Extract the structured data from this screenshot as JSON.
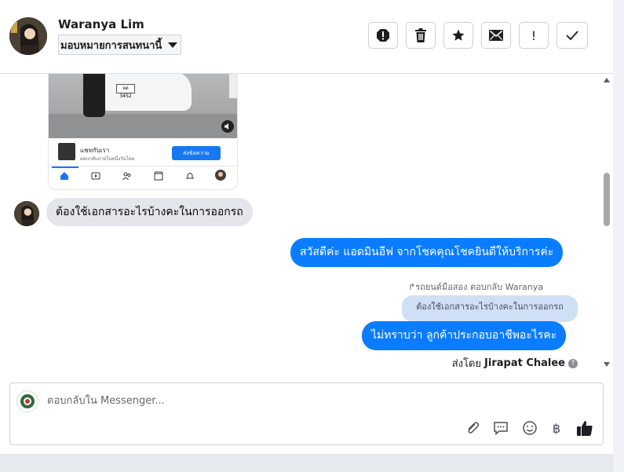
{
  "header": {
    "name": "Waranya Lim",
    "assign_label": "มอบหมายการสนทนานี้",
    "actions": [
      "spam-icon",
      "trash-icon",
      "star-icon",
      "envelope-icon",
      "important-icon",
      "check-icon"
    ],
    "important_glyph": "!"
  },
  "phone_preview": {
    "plate": "จต 3452",
    "card_title": "แชทกับเรา",
    "card_sub": "ตอบกลับภายในหนึ่งวันโดย",
    "card_button": "ส่งข้อความ"
  },
  "messages": {
    "incoming_1": "ต้องใช้เอกสารอะไรบ้างคะในการออกรถ",
    "outgoing_1": "สวัสดีค่ะ แอดมินอีฟ จากโชคคุณโชคยินดีให้บริการค่ะ",
    "reply_note": "รถยนต์มือสอง ตอบกลับ Waranya",
    "quoted": "ต้องใช้เอกสารอะไรบ้างคะในการออกรถ",
    "outgoing_2": "ไม่ทราบว่า ลูกค้าประกอบอาชีพอะไรคะ",
    "sent_by_label": "ส่งโดย",
    "sent_by_name": "Jirapat Chalee",
    "info_glyph": "?"
  },
  "composer": {
    "placeholder": "ตอบกลับใน Messenger...",
    "value": "",
    "baht_glyph": "฿"
  },
  "colors": {
    "accent": "#0a7cff",
    "incoming_bg": "#e4e6eb",
    "quoted_bg": "#cfe0f6"
  }
}
